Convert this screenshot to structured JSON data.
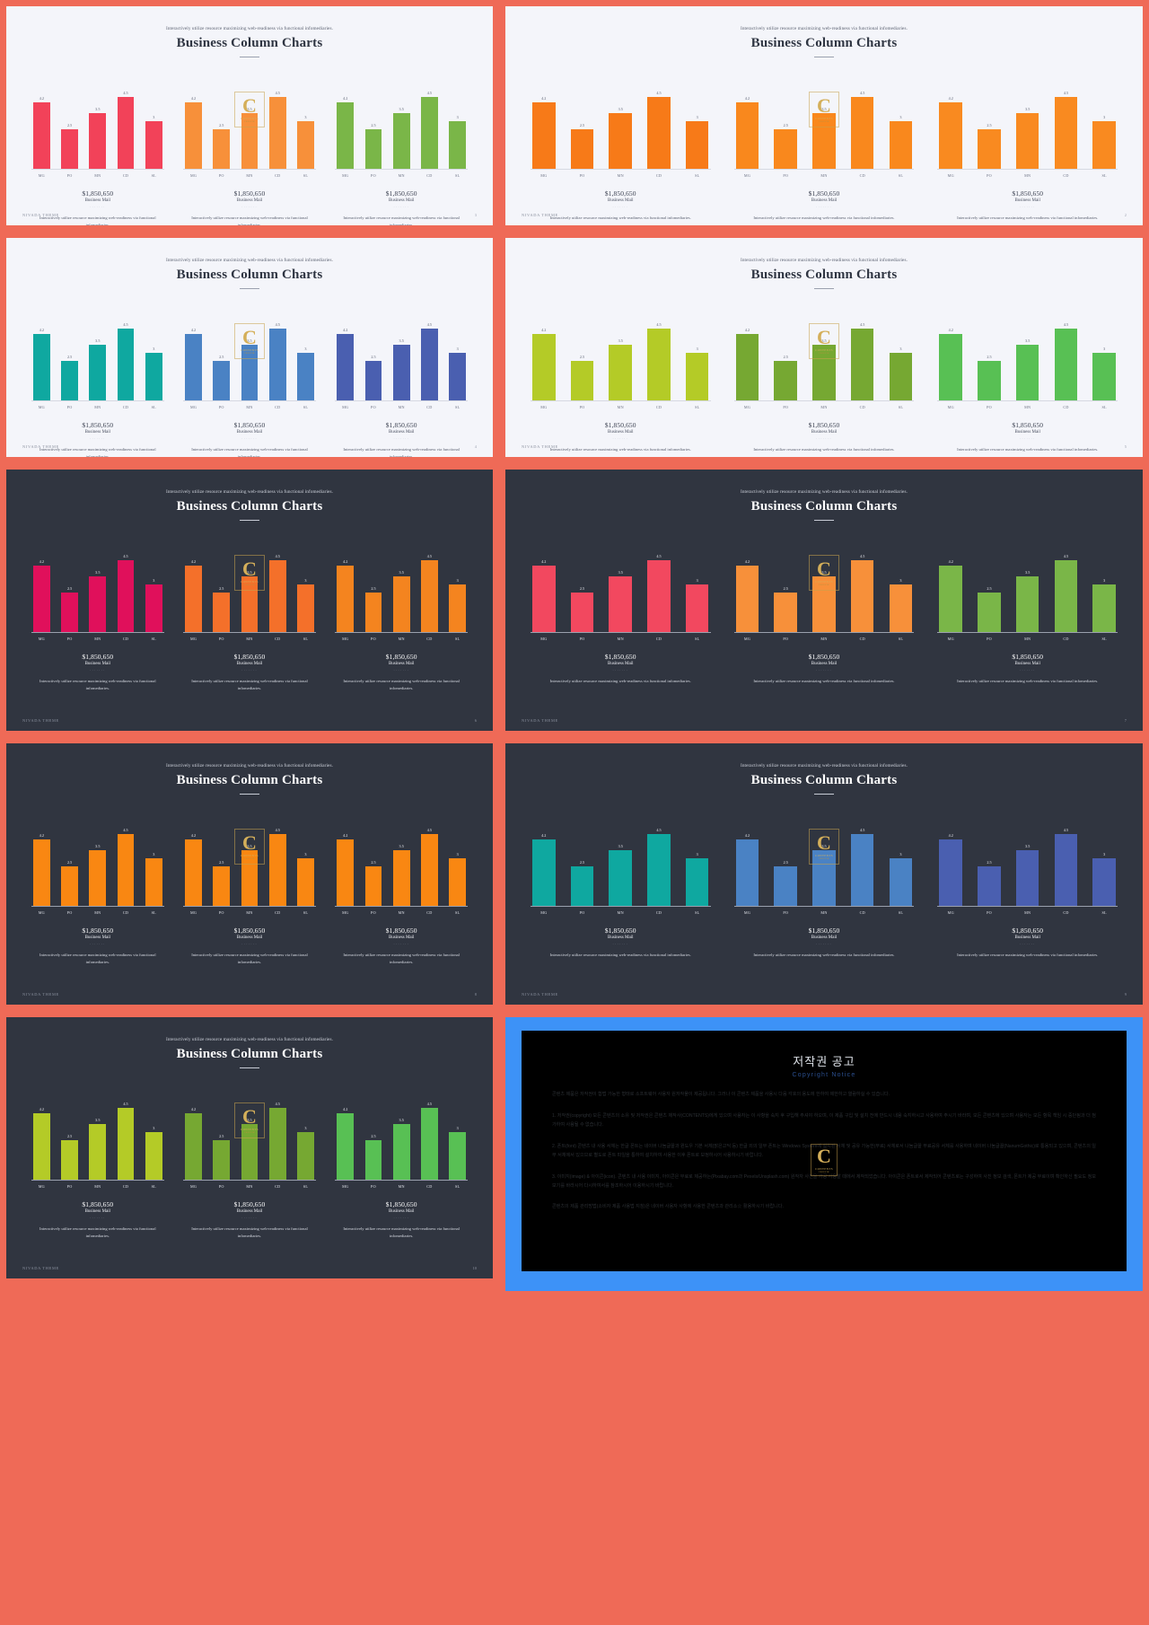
{
  "slide": {
    "subtitle": "Interactively utilize resource maximizing web-readiness via functional infomediaries.",
    "title": "Business Column Charts",
    "amount": "$1,850,650",
    "amount_label": "Business Mail",
    "dots": "·······",
    "description": "Interactively utilize resource maximizing web-readiness via functional infomediaries.",
    "footer": "NIVADA THEME"
  },
  "watermark": {
    "letter": "C",
    "line1": "CONTENTS",
    "line2": "FREEPIK"
  },
  "chart_data": {
    "type": "bar",
    "categories": [
      "MG",
      "PO",
      "MN",
      "CD",
      "SL"
    ],
    "values": [
      4.2,
      2.5,
      3.5,
      4.5,
      3
    ],
    "labels": [
      "4.2",
      "2.5",
      "3.5",
      "4.5",
      "3"
    ],
    "title": "Business Column Charts",
    "xlabel": "",
    "ylabel": "",
    "ylim": [
      0,
      5
    ],
    "grid": false,
    "legend": "none"
  },
  "panels": [
    {
      "id": 1,
      "theme": "light",
      "page": "3",
      "colors": [
        "#f24259",
        "#f7903a",
        "#7ab648"
      ]
    },
    {
      "id": 2,
      "theme": "light",
      "page": "2",
      "colors": [
        "#f77a18",
        "#f9881d",
        "#f98a20"
      ]
    },
    {
      "id": 3,
      "theme": "light",
      "page": "4",
      "colors": [
        "#0fa8a0",
        "#4a82c4",
        "#4a5fb0"
      ]
    },
    {
      "id": 4,
      "theme": "light",
      "page": "5",
      "colors": [
        "#b4cb27",
        "#76a832",
        "#58c054"
      ]
    },
    {
      "id": 5,
      "theme": "dark",
      "page": "6",
      "colors": [
        "#e0105b",
        "#f4702a",
        "#f4841f"
      ]
    },
    {
      "id": 6,
      "theme": "dark",
      "page": "7",
      "colors": [
        "#f2485f",
        "#f7903a",
        "#7ab648"
      ]
    },
    {
      "id": 7,
      "theme": "dark",
      "page": "8",
      "colors": [
        "#f98712",
        "#f98712",
        "#f98712"
      ]
    },
    {
      "id": 8,
      "theme": "dark",
      "page": "9",
      "colors": [
        "#0fa8a0",
        "#4a82c4",
        "#4a5fb0"
      ]
    },
    {
      "id": 9,
      "theme": "dark",
      "page": "10",
      "colors": [
        "#b4cb27",
        "#76a832",
        "#58c054"
      ]
    }
  ],
  "copyright": {
    "title": "저작권 공고",
    "subtitle": "Copyright Notice",
    "paragraphs": [
      "콘텐츠 제품은 저작권이 합법 가능한 형태로 소프트웨어 사용자 원저작물이 제공됩니다. 그러나 이 콘텐츠 제품을 사용시 다음 각호의 용도에 한하여 제한하고 열람하실 수 있습니다.",
      "1. 저작권(copyright) 모든 콘텐츠의 소유 및 저작권은 콘텐츠 제작사(CONTENTS)에게 있으며 사용자는 이 사항을 숙지 후 구입해 주셔야 하오며, 이 제품 구입 및 설치 전에 반드시 내용 숙지하시고 사용하여 주시기 바라며, 모든 콘텐츠에 있으며 사용자는 모든 항목 책임 시 중단됨과 더 첨가하여 사용될 수 없습니다.",
      "2. 폰트(font) 콘텐츠 내 사용 서체는 한글 폰트는 네이버 나눔글꼴과 윈도우 기본 서체(맑은고딕 등) 한글 외의 일부 폰트는 Windows System에 설치된 서체 및 공유 가능한(무료) 서체로서 나눔글꼴 무료공유 서체를 사용하며 네이버 나눔글꼴(NanumGothic)로 통용되고 있으며, 콘텐츠의 일부 서체에서 있으므로 별도로 폰트 파일을 통하여 설치하여 사용한 이후 폰트로 보정하시어 사용하시기 바랍니다.",
      "3. 이미지(image) & 아이콘(icon). 콘텐츠 내 사용 이미지, 아이콘은 무료로 제공하는(Pixabay.com과 Pexels/Unsplash.com) 원작자 사진을 가공 사용할 때에서 제작되었습니다. 아이콘은 폰트로서 제작되어 콘텐츠로는 구성하여 사진 정보 검색, 폰트가 제공 무료이며 확인하신 필요도 정보 보기를 바라시어 다시하여서를 참조하시어 이용하시기 바랍니다.",
      "콘텐츠의 제품 관리방법(소비자 제품 사용법 지침)은 네이버 사용자 사항에 사용한 콘텐츠과 관리소☆ 활용하시기 바랍니다."
    ],
    "logo": {
      "letter": "C",
      "line1": "CONTENTS",
      "line2": "FREEPIK"
    }
  }
}
